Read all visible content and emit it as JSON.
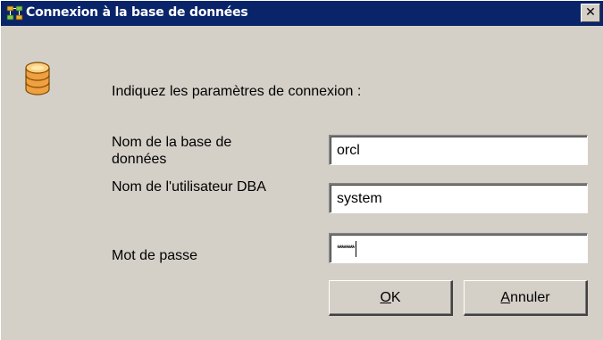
{
  "window": {
    "title": "Connexion à la base de données",
    "close_glyph": "✕"
  },
  "icons": {
    "title_icon": "database-tree-icon",
    "main_icon": "database-icon"
  },
  "form": {
    "instructions": "Indiquez les paramètres de connexion :",
    "db_name_label": "Nom de la base de données",
    "db_name_value": "orcl",
    "dba_user_label": "Nom de l'utilisateur DBA",
    "dba_user_value": "system",
    "password_label": "Mot de passe",
    "password_masked": "********"
  },
  "buttons": {
    "ok_mnemonic": "O",
    "ok_rest": "K",
    "cancel_mnemonic": "A",
    "cancel_rest": "nnuler"
  },
  "colors": {
    "titlebar": "#0a246a",
    "dialog_bg": "#d4d0c8",
    "db_icon_fill": "#f0a040"
  }
}
